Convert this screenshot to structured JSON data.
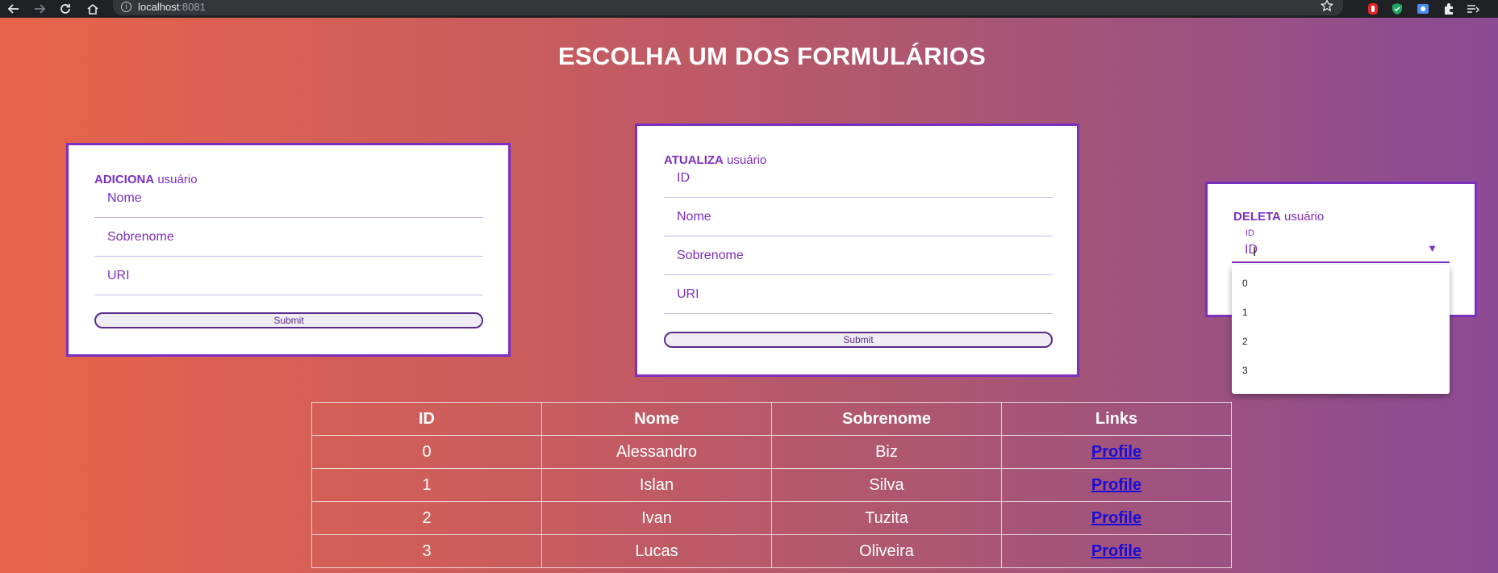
{
  "browser": {
    "url_host": "localhost",
    "url_port": ":8081"
  },
  "page": {
    "title": "ESCOLHA UM DOS FORMULÁRIOS"
  },
  "add_form": {
    "title_bold": "ADICIONA",
    "title_rest": " usuário",
    "fields": [
      {
        "placeholder": "Nome"
      },
      {
        "placeholder": "Sobrenome"
      },
      {
        "placeholder": "URI"
      }
    ],
    "submit_label": "Submit"
  },
  "update_form": {
    "title_bold": "ATUALIZA",
    "title_rest": " usuário",
    "fields": [
      {
        "placeholder": "ID"
      },
      {
        "placeholder": "Nome"
      },
      {
        "placeholder": "Sobrenome"
      },
      {
        "placeholder": "URI"
      }
    ],
    "submit_label": "Submit"
  },
  "delete_form": {
    "title_bold": "DELETA",
    "title_rest": " usuário",
    "select_label": "ID",
    "select_value": "ID",
    "options": [
      "0",
      "1",
      "2",
      "3"
    ]
  },
  "table": {
    "headers": [
      "ID",
      "Nome",
      "Sobrenome",
      "Links"
    ],
    "rows": [
      {
        "id": "0",
        "nome": "Alessandro",
        "sobrenome": "Biz",
        "link": "Profile"
      },
      {
        "id": "1",
        "nome": "Islan",
        "sobrenome": "Silva",
        "link": "Profile"
      },
      {
        "id": "2",
        "nome": "Ivan",
        "sobrenome": "Tuzita",
        "link": "Profile"
      },
      {
        "id": "3",
        "nome": "Lucas",
        "sobrenome": "Oliveira",
        "link": "Profile"
      }
    ]
  },
  "colors": {
    "accent": "#7b2fbf",
    "link": "#1a0dd8"
  }
}
